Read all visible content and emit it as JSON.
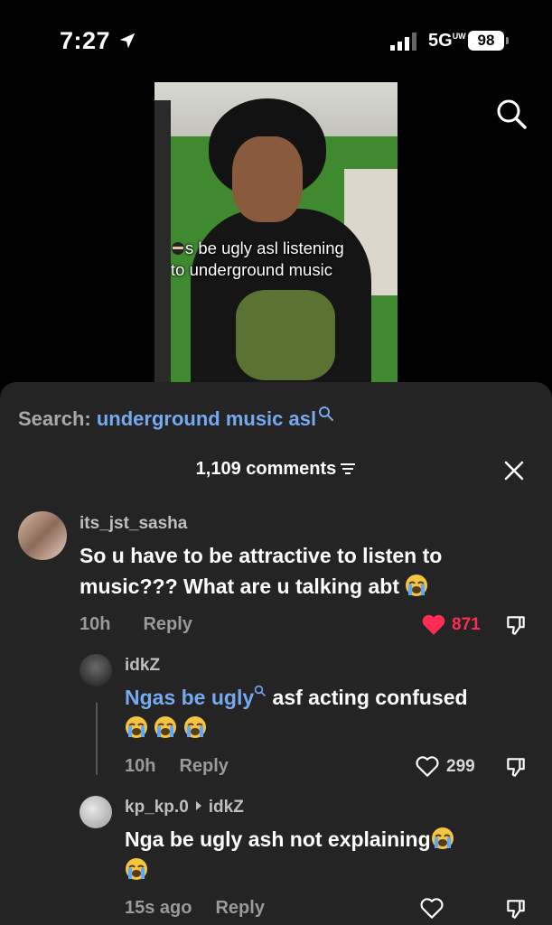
{
  "status_bar": {
    "time": "7:27",
    "network": "5G",
    "network_sup": "UW",
    "battery": "98"
  },
  "video": {
    "caption_line1": "s be ugly asl listening",
    "caption_line2": "to underground music"
  },
  "panel": {
    "search_label": "Search:",
    "search_query": "underground music asl",
    "comments_count": "1,109 comments"
  },
  "comments": [
    {
      "username": "its_jst_sasha",
      "text_line1": "So u have to be attractive to listen to",
      "text_line2": "music??? What are u talking abt",
      "time": "10h",
      "reply": "Reply",
      "likes": "871"
    },
    {
      "username": "idkZ",
      "highlight": "Ngas be ugly",
      "text_rest": " asf acting confused",
      "time": "10h",
      "reply": "Reply",
      "likes": "299"
    },
    {
      "username": "kp_kp.0",
      "reply_to": "idkZ",
      "text": "Nga be ugly ash not explaining",
      "time": "15s ago",
      "reply": "Reply"
    }
  ],
  "colors": {
    "accent": "#76a9f0",
    "like_red": "#fe2c55",
    "panel_bg": "#242424"
  }
}
